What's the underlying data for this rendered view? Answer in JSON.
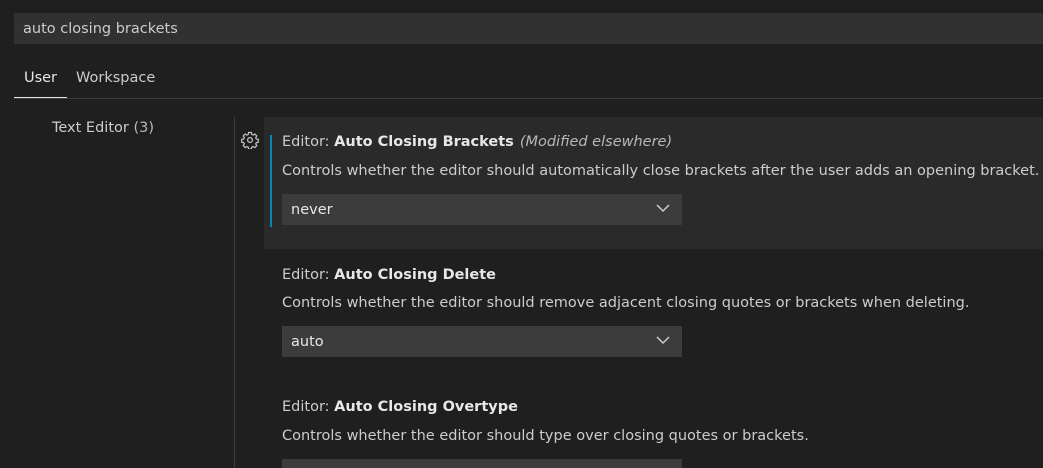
{
  "search": {
    "value": "auto closing brackets"
  },
  "tabs": [
    {
      "label": "User"
    },
    {
      "label": "Workspace"
    }
  ],
  "toc": {
    "label": "Text Editor",
    "count": "(3)"
  },
  "settings": [
    {
      "category": "Editor: ",
      "name": "Auto Closing Brackets",
      "modified": "(Modified elsewhere)",
      "description": "Controls whether the editor should automatically close brackets after the user adds an opening bracket.",
      "value": "never"
    },
    {
      "category": "Editor: ",
      "name": "Auto Closing Delete",
      "description": "Controls whether the editor should remove adjacent closing quotes or brackets when deleting.",
      "value": "auto"
    },
    {
      "category": "Editor: ",
      "name": "Auto Closing Overtype",
      "description": "Controls whether the editor should type over closing quotes or brackets."
    }
  ],
  "colors": {
    "background": "#1f1f1f",
    "input_background": "#313131",
    "select_background": "#3c3c3c",
    "modified_indicator": "#0e83b7"
  },
  "icons": {
    "gear": "gear-icon",
    "chevron": "chevron-down-icon"
  }
}
